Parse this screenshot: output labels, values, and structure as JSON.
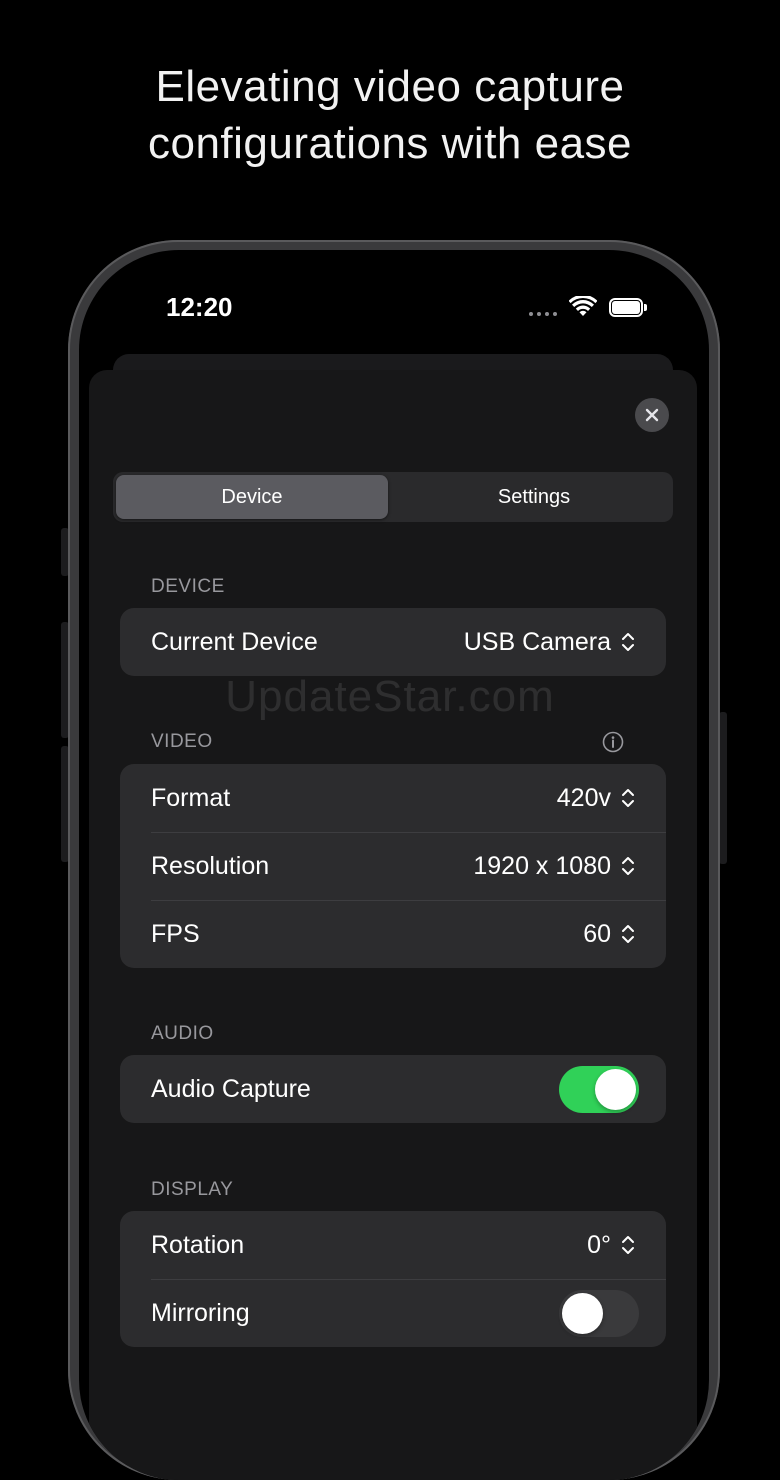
{
  "headline": {
    "line1": "Elevating video capture",
    "line2": "configurations with ease"
  },
  "status_bar": {
    "time": "12:20",
    "icons": [
      "signal-dots-icon",
      "wifi-icon",
      "battery-icon"
    ]
  },
  "sheet": {
    "close_icon": "close-icon"
  },
  "segmented": {
    "items": [
      "Device",
      "Settings"
    ],
    "selected": "Device"
  },
  "sections": {
    "device": {
      "label": "DEVICE",
      "rows": [
        {
          "label": "Current Device",
          "value": "USB Camera"
        }
      ]
    },
    "video": {
      "label": "VIDEO",
      "info_icon": "info-icon",
      "rows": [
        {
          "label": "Format",
          "value": "420v"
        },
        {
          "label": "Resolution",
          "value": "1920 x 1080"
        },
        {
          "label": "FPS",
          "value": "60"
        }
      ]
    },
    "audio": {
      "label": "AUDIO",
      "rows": [
        {
          "label": "Audio Capture",
          "toggle": true
        }
      ]
    },
    "display": {
      "label": "DISPLAY",
      "rows": [
        {
          "label": "Rotation",
          "value": "0°"
        },
        {
          "label": "Mirroring",
          "toggle": false
        }
      ]
    }
  },
  "watermark": "UpdateStar.com",
  "colors": {
    "toggle_on": "#30d158",
    "background": "#000000",
    "group": "#2c2c2e"
  }
}
